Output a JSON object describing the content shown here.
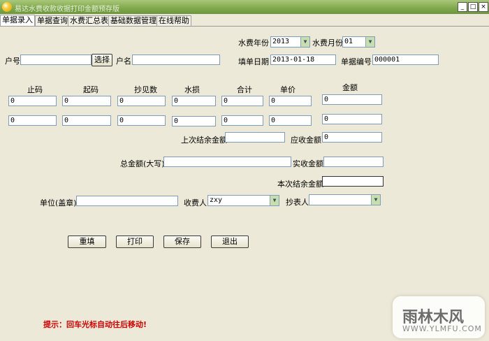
{
  "window": {
    "title": "易达水费收款收据打印金额预存版",
    "min": "_",
    "max": "□",
    "close": "×"
  },
  "tabs": [
    {
      "label": "单据录入",
      "active": true
    },
    {
      "label": "单据查询"
    },
    {
      "label": "水费汇总表"
    },
    {
      "label": "基础数据管理"
    },
    {
      "label": "在线帮助"
    }
  ],
  "form": {
    "year_label": "水费年份",
    "year_value": "2013",
    "month_label": "水费月份",
    "month_value": "01",
    "account_label": "户号",
    "account_value": "",
    "choose_button": "选择",
    "name_label": "户名",
    "name_value": "",
    "date_label": "填单日期",
    "date_value": "2013-01-18",
    "receipt_no_label": "单据编号",
    "receipt_no_value": "000001"
  },
  "meter": {
    "headers": [
      "止码",
      "起码",
      "抄见数",
      "水损",
      "合计",
      "单价",
      "金额"
    ],
    "row1": [
      "0",
      "0",
      "0",
      "0",
      "0",
      "0",
      "0"
    ],
    "row2": [
      "0",
      "0",
      "0",
      "0",
      "0",
      "0",
      "0"
    ]
  },
  "summary": {
    "last_balance_label": "上次结余金额",
    "last_balance_value": "",
    "receivable_label": "应收金额",
    "receivable_value": "0",
    "total_upper_label": "总金额(大写)",
    "total_upper_value": "",
    "received_label": "实收金额",
    "received_value": "",
    "this_balance_label": "本次结余金额",
    "this_balance_value": "",
    "unit_label": "单位(盖章)",
    "unit_value": "",
    "collector_label": "收费人",
    "collector_value": "zxy",
    "reader_label": "抄表人",
    "reader_value": ""
  },
  "buttons": {
    "reset": "重填",
    "print": "打印",
    "save": "保存",
    "exit": "退出"
  },
  "hint": "提示：回车光标自动往后移动!",
  "watermark": {
    "main": "雨林木风",
    "sub": "WWW.YLMFU.COM"
  },
  "colors": {
    "titlebar": "#7fa84a",
    "hint": "#d00000",
    "field_border": "#7f9db9"
  }
}
